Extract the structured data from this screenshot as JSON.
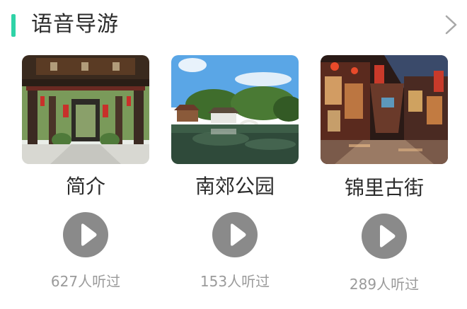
{
  "section": {
    "title": "语音导游",
    "more_icon": "chevron-right-icon",
    "accent_color": "#2fd3a7"
  },
  "guides": [
    {
      "name": "简介",
      "listens": "627人听过",
      "thumb": "ancestral-temple-gate"
    },
    {
      "name": "南郊公园",
      "listens": "153人听过",
      "thumb": "park-pond-pavilion"
    },
    {
      "name": "锦里古街",
      "listens": "289人听过",
      "thumb": "old-street-night"
    }
  ],
  "play_icon": "play-icon",
  "play_button_color": "#8a8a8a"
}
